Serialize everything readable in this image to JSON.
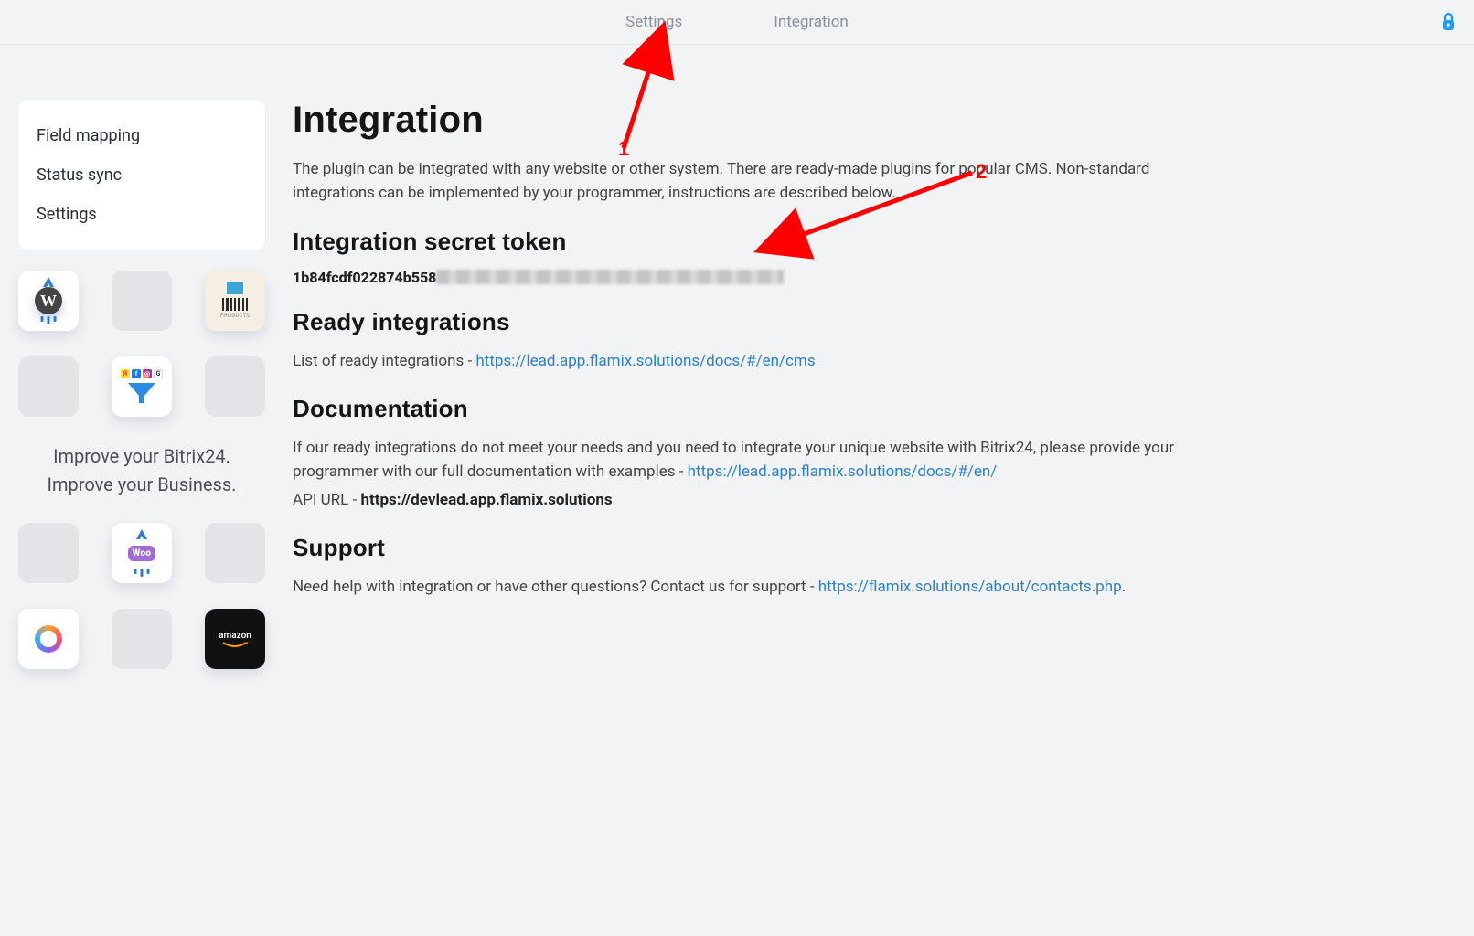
{
  "tabs": {
    "settings": "Settings",
    "integration": "Integration"
  },
  "sidebar": {
    "items": [
      {
        "label": "Field mapping"
      },
      {
        "label": "Status sync"
      },
      {
        "label": "Settings"
      }
    ]
  },
  "promo": {
    "line1": "Improve your Bitrix24.",
    "line2": "Improve your Business.",
    "woo_label": "Woo",
    "amazon_label": "amazon",
    "barcode_label": "PRODUCTS",
    "brand_y": "Я",
    "brand_f": "f",
    "brand_i": "◎",
    "brand_g": "G",
    "wp_letter": "W"
  },
  "main": {
    "h1": "Integration",
    "intro": "The plugin can be integrated with any website or other system. There are ready-made plugins for popular CMS. Non-standard integrations can be implemented by your programmer, instructions are described below.",
    "token_heading": "Integration secret token",
    "token_prefix": "1b84fcdf022874b558",
    "ready_heading": "Ready integrations",
    "ready_text": "List of ready integrations - ",
    "ready_link": "https://lead.app.flamix.solutions/docs/#/en/cms",
    "doc_heading": "Documentation",
    "doc_text": "If our ready integrations do not meet your needs and you need to integrate your unique website with Bitrix24, please provide your programmer with our full documentation with examples - ",
    "doc_link": "https://lead.app.flamix.solutions/docs/#/en/",
    "api_label": "API URL - ",
    "api_url": "https://devlead.app.flamix.solutions",
    "support_heading": "Support",
    "support_text": "Need help with integration or have other questions? Contact us for support - ",
    "support_link": "https://flamix.solutions/about/contacts.php",
    "period": "."
  },
  "annotations": {
    "one": "1",
    "two": "2"
  }
}
